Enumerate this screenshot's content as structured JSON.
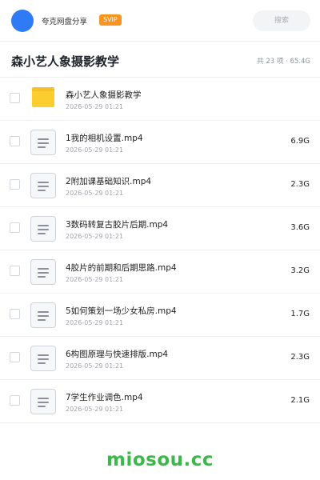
{
  "topbar": {
    "share_title": "夸克网盘分享",
    "svip_badge": "SVIP",
    "search_placeholder": "搜索"
  },
  "folder": {
    "title": "森小艺人象摄影教学",
    "meta": "共 23 项 · 65.4G"
  },
  "files": [
    {
      "name": "森小艺人象摄影教学",
      "date": "2026-05-29 01:21",
      "size": "",
      "type": "folder"
    },
    {
      "name": "1我的相机设置.mp4",
      "date": "2026-05-29 01:21",
      "size": "6.9G",
      "type": "video"
    },
    {
      "name": "2附加课基础知识.mp4",
      "date": "2026-05-29 01:21",
      "size": "2.3G",
      "type": "video"
    },
    {
      "name": "3数码转复古胶片后期.mp4",
      "date": "2026-05-29 01:21",
      "size": "3.6G",
      "type": "video"
    },
    {
      "name": "4胶片的前期和后期思路.mp4",
      "date": "2026-05-29 01:21",
      "size": "3.2G",
      "type": "video"
    },
    {
      "name": "5如何策划一场少女私房.mp4",
      "date": "2026-05-29 01:21",
      "size": "1.7G",
      "type": "video"
    },
    {
      "name": "6构图原理与快速排版.mp4",
      "date": "2026-05-29 01:21",
      "size": "2.3G",
      "type": "video"
    },
    {
      "name": "7学生作业调色.mp4",
      "date": "2026-05-29 01:21",
      "size": "2.1G",
      "type": "video"
    }
  ],
  "watermark": "miosou.cc",
  "colors": {
    "avatar": "#2f7bf6",
    "svip": "#f7931e",
    "folder_icon": "#fbcd2f",
    "watermark": "#3cb84a"
  }
}
